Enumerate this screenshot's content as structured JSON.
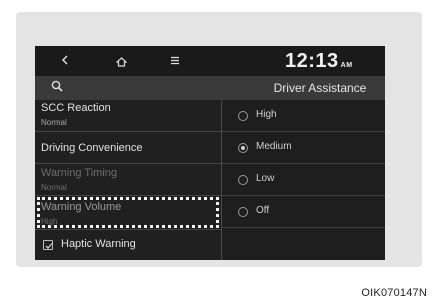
{
  "topbar": {
    "back_icon": "chevron-left-icon",
    "home_icon": "home-icon",
    "menu_icon": "menu-icon",
    "time": "12:13",
    "ampm": "AM"
  },
  "header": {
    "search_icon": "search-icon",
    "title": "Driver Assistance"
  },
  "list": {
    "items": [
      {
        "label": "SCC Reaction",
        "sub": "Normal"
      },
      {
        "label": "Driving Convenience",
        "sub": ""
      },
      {
        "label": "Warning Timing",
        "sub": "Normal"
      },
      {
        "label": "Warning Volume",
        "sub": "High"
      },
      {
        "label": "Haptic Warning",
        "sub": ""
      }
    ]
  },
  "options": [
    {
      "label": "High",
      "selected": false
    },
    {
      "label": "Medium",
      "selected": true
    },
    {
      "label": "Low",
      "selected": false
    },
    {
      "label": "Off",
      "selected": false
    }
  ],
  "caption": "OIK070147N"
}
